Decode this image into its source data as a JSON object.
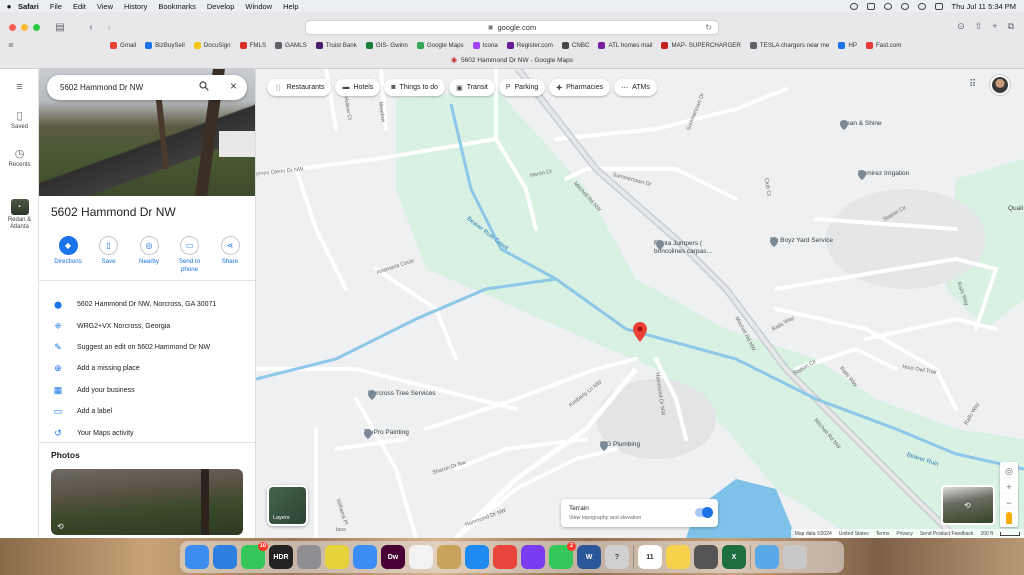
{
  "menubar": {
    "app": "Safari",
    "items": [
      "File",
      "Edit",
      "View",
      "History",
      "Bookmarks",
      "Develop",
      "Window",
      "Help"
    ],
    "clock": "Thu Jul 11  5:34 PM"
  },
  "browser": {
    "url": "google.com",
    "tab_title": "5602 Hammond Dr NW - Google Maps",
    "bookmarks": [
      {
        "label": "Gmail",
        "color": "#ea4335"
      },
      {
        "label": "BizBuySell",
        "color": "#1a73e8"
      },
      {
        "label": "DocuSign",
        "color": "#f5c518"
      },
      {
        "label": "FMLS",
        "color": "#d93025"
      },
      {
        "label": "GAMLS",
        "color": "#5f6368"
      },
      {
        "label": "Truist Bank",
        "color": "#4b1e6d"
      },
      {
        "label": "GIS- Gwinn",
        "color": "#188038"
      },
      {
        "label": "Google Maps",
        "color": "#34a853"
      },
      {
        "label": "Icona",
        "color": "#a142f4"
      },
      {
        "label": "Register.com",
        "color": "#6a1b9a"
      },
      {
        "label": "CNBC",
        "color": "#444444"
      },
      {
        "label": "ATL homes mail",
        "color": "#7b1fa2"
      },
      {
        "label": "MAP- SUPERCHARGER",
        "color": "#c5221f"
      },
      {
        "label": "TESLA chargers near me",
        "color": "#5f6368"
      },
      {
        "label": "HP",
        "color": "#1a73e8"
      },
      {
        "label": "Fast.com",
        "color": "#e53935"
      }
    ]
  },
  "rail": {
    "saved": "Saved",
    "recents": "Recents",
    "thumb_label": "Redan & Atlanta"
  },
  "panel": {
    "search_value": "5602 Hammond Dr NW",
    "title": "5602 Hammond Dr NW",
    "actions": [
      {
        "label": "Directions",
        "icon": "directions-icon",
        "glyph": "◆"
      },
      {
        "label": "Save",
        "icon": "bookmark-icon",
        "glyph": "▯"
      },
      {
        "label": "Nearby",
        "icon": "nearby-icon",
        "glyph": "◎"
      },
      {
        "label": "Send to phone",
        "icon": "phone-icon",
        "glyph": "▭"
      },
      {
        "label": "Share",
        "icon": "share-icon",
        "glyph": "⋖"
      }
    ],
    "info": [
      {
        "text": "5602 Hammond Dr NW, Norcross, GA 30071",
        "icon": "location-pin-icon",
        "glyph": "⬤"
      },
      {
        "text": "WRG2+VX Norcross, Georgia",
        "icon": "plus-code-icon",
        "glyph": "⁜"
      },
      {
        "text": "Suggest an edit on 5602 Hammond Dr NW",
        "icon": "pencil-icon",
        "glyph": "✎"
      },
      {
        "text": "Add a missing place",
        "icon": "add-place-icon",
        "glyph": "⊕"
      },
      {
        "text": "Add your business",
        "icon": "storefront-icon",
        "glyph": "▦"
      },
      {
        "text": "Add a label",
        "icon": "label-icon",
        "glyph": "▭"
      },
      {
        "text": "Your Maps activity",
        "icon": "history-icon",
        "glyph": "↺"
      }
    ],
    "photos_heading": "Photos"
  },
  "map": {
    "chips": [
      {
        "label": "Restaurants",
        "icon": "fork-knife-icon",
        "glyph": "🍴"
      },
      {
        "label": "Hotels",
        "icon": "bed-icon",
        "glyph": "▬"
      },
      {
        "label": "Things to do",
        "icon": "camera-icon",
        "glyph": "◙"
      },
      {
        "label": "Transit",
        "icon": "bus-icon",
        "glyph": "▣"
      },
      {
        "label": "Parking",
        "icon": "parking-icon",
        "glyph": "P"
      },
      {
        "label": "Pharmacies",
        "icon": "pharmacy-icon",
        "glyph": "✚"
      },
      {
        "label": "ATMs",
        "icon": "atm-icon",
        "glyph": "⋯"
      }
    ],
    "pois": {
      "clean_shine": "Clean & Shine",
      "ramirez": "Ramirez Irrigation",
      "da_boyz": "Da Boyz Yard Service",
      "renta_jumpers": "Renta Jumpers (",
      "renta_jumpers_2": "brincolines carpas...",
      "norcross_tree": "Norcross Tree Services",
      "trupro": "TruPro Painting",
      "bg_plumbing": "B G Plumbing"
    },
    "roads": {
      "mitchell_1": "Mitchell Rd NW",
      "mitchell_2": "Mitchell Rd NW",
      "mitchell_3": "Mitchell Rd NW",
      "summertown_1": "Summertown Dr",
      "summertown_2": "Summertown Dr",
      "heron": "Heron Ct",
      "anamaria": "Anamaria Circle",
      "kimberly": "Kimberly Ln NW",
      "hammond_1": "Hammond Dr NW",
      "hammond_2": "Hammond Dr NW",
      "sharon": "Sharon Dr Nw",
      "station_1": "Station Cir",
      "station_2": "Station Cir",
      "rails_1": "Rails Way",
      "rails_2": "Rails Way",
      "rails_3": "Rails Way",
      "rails_4": "Rails Way",
      "hoot_owl": "Hoot Owl Trail",
      "glenn": "pines Glenn Dr NW",
      "hollow": "Fern Hollow Ct",
      "meadow": "Meadow",
      "williams": "Williams Pl",
      "club": "Club Ct",
      "lass": "lass",
      "qual": "Quali"
    },
    "creek": "Beaver Ruin Creek",
    "creek_2": "Beaver Ruin",
    "layers_label": "Layers",
    "terrain_title": "Terrain",
    "terrain_sub": "View topography and elevation",
    "terrain_on": true,
    "attribution": [
      "Map data ©2024",
      "United States",
      "Terms",
      "Privacy",
      "Send Product Feedback",
      "200 ft"
    ]
  },
  "dock": {
    "apps": [
      {
        "name": "finder-icon",
        "color": "#3b8ef0"
      },
      {
        "name": "safari-icon",
        "color": "#2d7fe0"
      },
      {
        "name": "messages-icon",
        "color": "#35c759",
        "badge": "10"
      },
      {
        "name": "hdr-icon",
        "color": "#222222",
        "text": "HDR"
      },
      {
        "name": "settings-icon",
        "color": "#8e8e93"
      },
      {
        "name": "stickies-icon",
        "color": "#e6d23c"
      },
      {
        "name": "mail-icon",
        "color": "#3a8ef6"
      },
      {
        "name": "dreamweaver-icon",
        "color": "#470137",
        "text": "Dw"
      },
      {
        "name": "textedit-icon",
        "color": "#f2f2f2"
      },
      {
        "name": "archive-icon",
        "color": "#c9a25b"
      },
      {
        "name": "appstore-icon",
        "color": "#1d8bf1"
      },
      {
        "name": "chrome-icon",
        "color": "#e8453c"
      },
      {
        "name": "siri-icon",
        "color": "#7a3cf0"
      },
      {
        "name": "facetime-icon",
        "color": "#34c759",
        "badge": "2"
      },
      {
        "name": "word-icon",
        "color": "#2b579a",
        "text": "W"
      },
      {
        "name": "help-icon",
        "color": "#d0d0d0",
        "text": "?"
      },
      {
        "name": "calendar-icon",
        "color": "#ffffff",
        "text": "11"
      },
      {
        "name": "notes-icon",
        "color": "#f7d14b"
      },
      {
        "name": "calculator-icon",
        "color": "#555555"
      },
      {
        "name": "excel-icon",
        "color": "#1d6f42",
        "text": "X"
      },
      {
        "name": "folder-icon",
        "color": "#5aa9e6"
      },
      {
        "name": "trash-icon",
        "color": "#c8c8c8"
      }
    ]
  }
}
